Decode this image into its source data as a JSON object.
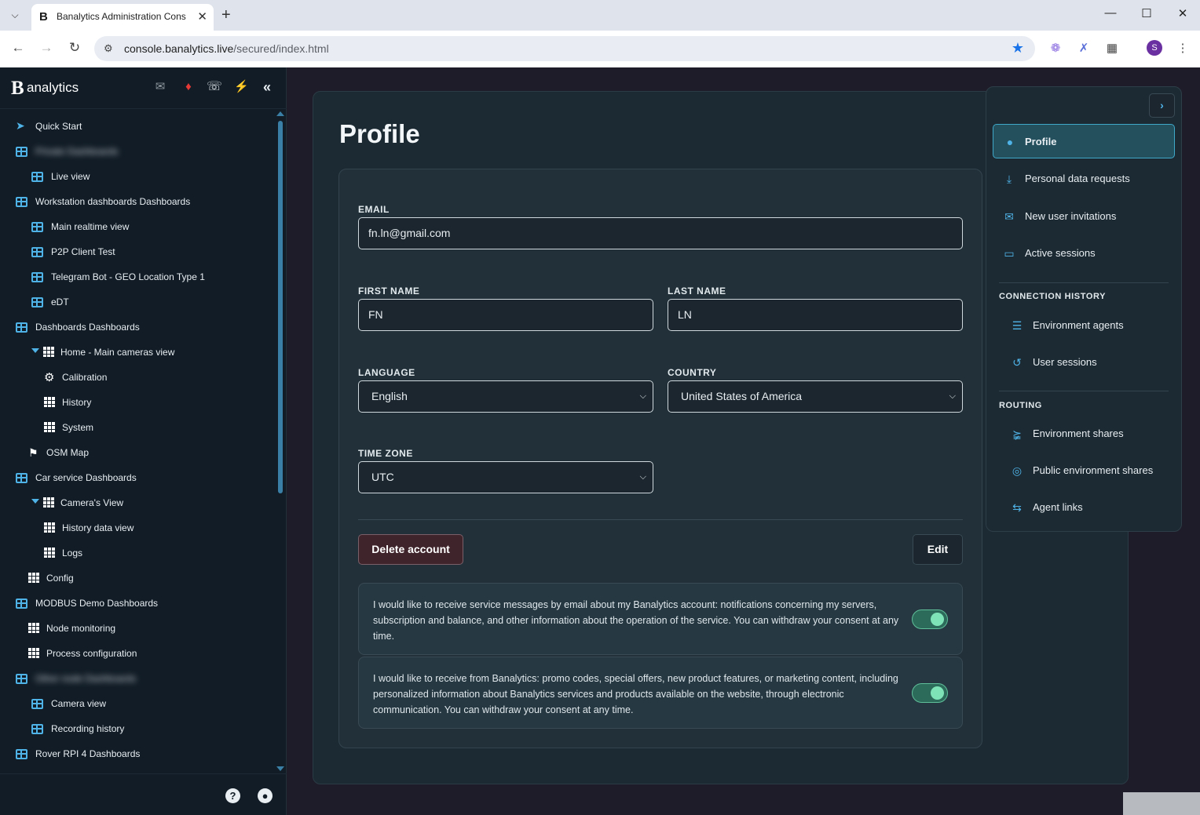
{
  "browser": {
    "tab_title": "Banalytics Administration Cons",
    "favicon_letter": "B",
    "url_host": "console.banalytics.live",
    "url_path": "/secured/index.html",
    "profile_letter": "S"
  },
  "sidebar": {
    "brand_letter": "B",
    "brand_text": "analytics",
    "items": [
      {
        "label": "Quick Start"
      },
      {
        "label": "Private Dashboards"
      },
      {
        "label": "Live view"
      },
      {
        "label": "Workstation dashboards Dashboards"
      },
      {
        "label": "Main realtime view"
      },
      {
        "label": "P2P Client Test"
      },
      {
        "label": "Telegram Bot - GEO Location Type 1"
      },
      {
        "label": "eDT"
      },
      {
        "label": "Dashboards Dashboards"
      },
      {
        "label": "Home - Main cameras view"
      },
      {
        "label": "Calibration"
      },
      {
        "label": "History"
      },
      {
        "label": "System"
      },
      {
        "label": "OSM Map"
      },
      {
        "label": "Car service Dashboards"
      },
      {
        "label": "Camera's View"
      },
      {
        "label": "History data view"
      },
      {
        "label": "Logs"
      },
      {
        "label": "Config"
      },
      {
        "label": "MODBUS Demo Dashboards"
      },
      {
        "label": "Node monitoring"
      },
      {
        "label": "Process configuration"
      },
      {
        "label": "Other node Dashboards"
      },
      {
        "label": "Camera view"
      },
      {
        "label": "Recording history"
      },
      {
        "label": "Rover RPI 4 Dashboards"
      }
    ]
  },
  "page": {
    "title": "Profile",
    "email_label": "EMAIL",
    "email_value": "fn.ln@gmail.com",
    "first_name_label": "FIRST NAME",
    "first_name_value": "FN",
    "last_name_label": "LAST NAME",
    "last_name_value": "LN",
    "language_label": "LANGUAGE",
    "language_value": "English",
    "country_label": "COUNTRY",
    "country_value": "United States of America",
    "timezone_label": "TIME ZONE",
    "timezone_value": "UTC",
    "delete_label": "Delete account",
    "edit_label": "Edit",
    "consent_service": "I would like to receive service messages by email about my Banalytics account: notifications concerning my servers, subscription and balance, and other information about the operation of the service. You can withdraw your consent at any time.",
    "consent_marketing": "I would like to receive from Banalytics: promo codes, special offers, new product features, or marketing content, including personalized information about Banalytics services and products available on the website, through electronic communication. You can withdraw your consent at any time.",
    "consent_service_on": true,
    "consent_marketing_on": true
  },
  "profile_menu": {
    "items": [
      {
        "label": "Profile",
        "icon": "user-circle-icon"
      },
      {
        "label": "Personal data requests",
        "icon": "download-icon"
      },
      {
        "label": "New user invitations",
        "icon": "envelope-icon"
      },
      {
        "label": "Active sessions",
        "icon": "monitor-icon"
      }
    ],
    "connection_history_title": "CONNECTION HISTORY",
    "connection_history": [
      {
        "label": "Environment agents",
        "icon": "server-icon"
      },
      {
        "label": "User sessions",
        "icon": "history-icon"
      }
    ],
    "routing_title": "ROUTING",
    "routing": [
      {
        "label": "Environment shares",
        "icon": "share-icon"
      },
      {
        "label": "Public environment shares",
        "icon": "globe-icon"
      },
      {
        "label": "Agent links",
        "icon": "exchange-icon"
      }
    ]
  },
  "colors": {
    "accent": "#4fb3e8",
    "background": "#1e1c28",
    "sidebar": "#111c26",
    "toggle_on": "#7fe3b8",
    "alert": "#e53935",
    "plug": "#4caf50"
  }
}
